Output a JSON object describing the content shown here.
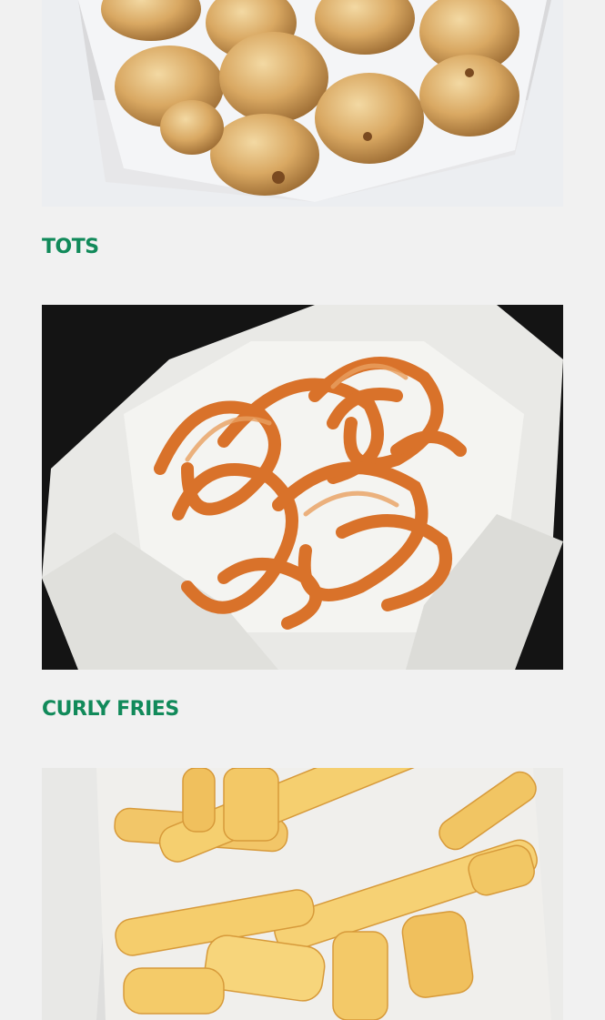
{
  "colors": {
    "page_background": "#f1f1f1",
    "title_color": "#118a5a"
  },
  "menu_items": [
    {
      "title": "TOTS",
      "image_icon": "tater-tots-photo"
    },
    {
      "title": "CURLY FRIES",
      "image_icon": "curly-fries-photo"
    },
    {
      "title": "",
      "image_icon": "french-fries-photo"
    }
  ]
}
